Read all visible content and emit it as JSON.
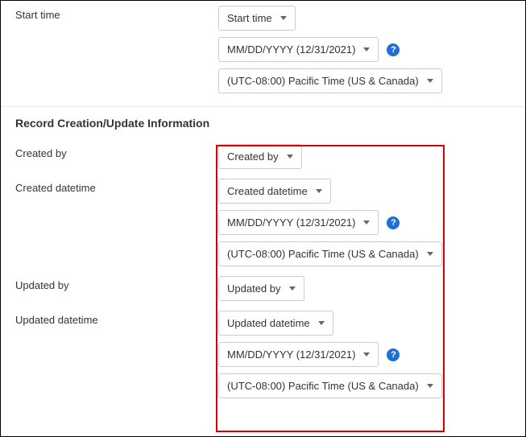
{
  "start_time": {
    "label": "Start time",
    "field_dropdown": "Start time",
    "date_format": "MM/DD/YYYY (12/31/2021)",
    "timezone": "(UTC-08:00) Pacific Time (US & Canada)"
  },
  "section_header": "Record Creation/Update Information",
  "created_by": {
    "label": "Created by",
    "field_dropdown": "Created by"
  },
  "created_datetime": {
    "label": "Created datetime",
    "field_dropdown": "Created datetime",
    "date_format": "MM/DD/YYYY (12/31/2021)",
    "timezone": "(UTC-08:00) Pacific Time (US & Canada)"
  },
  "updated_by": {
    "label": "Updated by",
    "field_dropdown": "Updated by"
  },
  "updated_datetime": {
    "label": "Updated datetime",
    "field_dropdown": "Updated datetime",
    "date_format": "MM/DD/YYYY (12/31/2021)",
    "timezone": "(UTC-08:00) Pacific Time (US & Canada)"
  },
  "help_glyph": "?"
}
